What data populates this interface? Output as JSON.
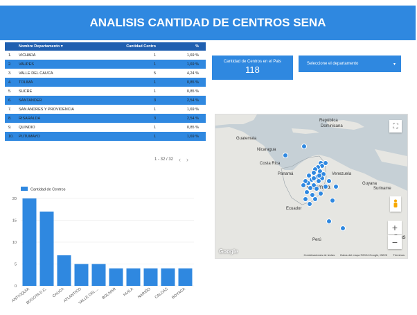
{
  "header": {
    "title": "ANALISIS CANTIDAD DE CENTROS SENA"
  },
  "table": {
    "headers": {
      "name": "Nombre Departamento",
      "sort_icon": "caret-down-icon",
      "count": "Cantidad Centro",
      "pct": "%"
    },
    "rows": [
      {
        "num": "1.",
        "name": "VICHADA",
        "count": "1",
        "pct": "1,69 %"
      },
      {
        "num": "2.",
        "name": "VAUPES",
        "count": "1",
        "pct": "1,69 %"
      },
      {
        "num": "3.",
        "name": "VALLE DEL CAUCA",
        "count": "5",
        "pct": "4,24 %"
      },
      {
        "num": "4.",
        "name": "TOLIMA",
        "count": "1",
        "pct": "0,85 %"
      },
      {
        "num": "5.",
        "name": "SUCRE",
        "count": "1",
        "pct": "0,85 %"
      },
      {
        "num": "6.",
        "name": "SANTANDER",
        "count": "3",
        "pct": "2,54 %"
      },
      {
        "num": "7.",
        "name": "SAN ANDRES Y PROVIDENCIA",
        "count": "1",
        "pct": "1,69 %"
      },
      {
        "num": "8.",
        "name": "RISARALDA",
        "count": "3",
        "pct": "2,54 %"
      },
      {
        "num": "9.",
        "name": "QUINDIO",
        "count": "1",
        "pct": "0,85 %"
      },
      {
        "num": "10.",
        "name": "PUTUMAYO",
        "count": "1",
        "pct": "1,69 %"
      }
    ],
    "pager": "1 - 32 / 32"
  },
  "scorecard": {
    "label": "Cantidad de Centros en el Pais",
    "value": "118"
  },
  "dropdown": {
    "label": "Seleccione el departamento"
  },
  "map": {
    "labels": {
      "republica": "República",
      "dominicana": "Dominicana",
      "guatemala": "Guatemala",
      "nicaragua": "Nicaragua",
      "costa_rica": "Costa Rica",
      "panama": "Panamá",
      "venezuela": "Venezuela",
      "colombia": "Colombia",
      "guyana": "Guyana",
      "suriname": "Suriname",
      "ecuador": "Ecuador",
      "peru": "Perú",
      "bras": "Bras"
    },
    "google": "Google",
    "attribution": [
      "Combinaciones de teclas",
      "Datos del mapa ©2024 Google, INEGI",
      "Términos"
    ]
  },
  "chart_data": {
    "type": "bar",
    "legend": "Cantidad de Centros",
    "categories": [
      "ANTIOQUIA",
      "BOGOTA D.C.",
      "CAUCA",
      "ATLANTICO",
      "VALLE DEL ...",
      "BOLIVAR",
      "HUILA",
      "NARIÑO",
      "CALDAS",
      "BOYACA"
    ],
    "values": [
      20,
      17,
      7,
      5,
      5,
      4,
      4,
      4,
      4,
      4
    ],
    "ylim": [
      0,
      20
    ],
    "yticks": [
      0,
      5,
      10,
      15,
      20
    ],
    "color": "#2f88e0",
    "grid": true
  }
}
